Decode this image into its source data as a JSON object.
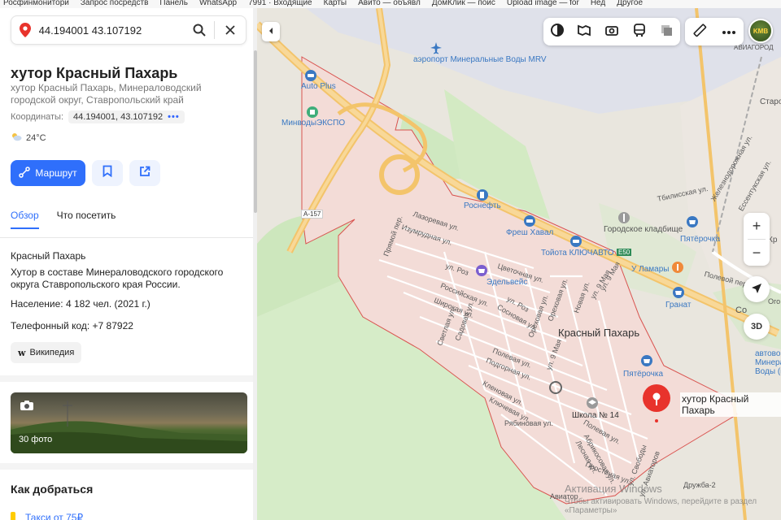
{
  "bookmarks": [
    "Росфинмонитори",
    "Запрос посредств",
    "Панель",
    "WhatsApp",
    "7991 · Входящие",
    "Карты",
    "Авито — объявл",
    "ДомКлик — поис",
    "Upload image — for",
    "Нед",
    "Другое"
  ],
  "search": {
    "value": "44.194001 43.107192"
  },
  "place": {
    "title": "хутор Красный Пахарь",
    "subtitle": "хутор Красный Пахарь, Минераловодский городской округ, Ставропольский край",
    "coords_label": "Координаты:",
    "coords_value": "44.194001, 43.107192",
    "weather": "24°C"
  },
  "actions": {
    "route_label": "Маршрут"
  },
  "tabs": [
    {
      "label": "Обзор",
      "active": true
    },
    {
      "label": "Что посетить",
      "active": false
    }
  ],
  "info": {
    "heading": "Красный Пахарь",
    "description": "Хутор в составе Минераловодского городского округа Ставропольского края России.",
    "population": "Население: 4 182 чел. (2021 г.)",
    "phone_code": "Телефонный код: +7 87922",
    "wiki_label": "Википедия"
  },
  "photos": {
    "count_label": "30 фото"
  },
  "howto": {
    "title": "Как добраться",
    "taxi": "Такси от 75₽"
  },
  "map": {
    "labels": {
      "airport": "аэропорт Минеральные Воды MRV",
      "autoplus": "Auto Plus",
      "expo": "МинводыЭКСПО",
      "a157": "А-157",
      "rosneft": "Роснефть",
      "fresh": "Фреш Хавал",
      "toyota": "Тойота КЛЮЧАВТО",
      "e50": "Е50",
      "cemetery": "Городское кладбище",
      "pyaterochka1": "Пятёрочка",
      "pyaterochka2": "Пятёрочка",
      "lamary": "У Ламары",
      "granat": "Гранат",
      "edelweiss": "Эдельвейс",
      "school": "Школа № 14",
      "village": "Красный Пахарь",
      "aviagorod": "АВИАГОРОД",
      "aviatorov": "Авиатор",
      "druzhba": "Дружба-2",
      "tbilisskaya": "Тбилисская ул.",
      "zheleznodor": "Железнодорожная ул.",
      "essentuk": "Ессентукская ул.",
      "staropol": "Старо",
      "polevoy": "Полевой пер.",
      "ogo": "Ого",
      "avtovokzal": "автовокзал Минеральные Воды (н",
      "so": "Со",
      "kr": "Кр"
    },
    "streets": [
      "Лазоревая ул.",
      "Изумрудная ул.",
      "Прямой пер.",
      "ул. Роз",
      "Цветочная ул.",
      "Российская ул.",
      "Широкая ул.",
      "Светлая ул.",
      "Садовая ул.",
      "Сосновая ул.",
      "ул. Роз",
      "Ореховая ул.",
      "Ореховая ул.",
      "Новая ул.",
      "ул. 9 Мая",
      "ул. 9 Мая",
      "Полевая ул.",
      "Подгорная ул.",
      "Кленовая ул.",
      "Ключевая ул.",
      "Рябиновая ул.",
      "Абрикосовая ул.",
      "Лесная ул.",
      "Полевая ул.",
      "Простоная ул.",
      "ул. Свободы",
      "ул. Авиаторов",
      "ул. 9 Мая"
    ],
    "pin_label": "хутор Красный Пахарь",
    "button_3d": "3D",
    "zoom_in": "+",
    "zoom_out": "−",
    "watermark_title": "Активация Windows",
    "watermark_sub": "Чтобы активировать Windows, перейдите в раздел «Параметры»"
  },
  "colors": {
    "accent": "#2f6ffb",
    "pin": "#e8332c",
    "boundary": "#d9534f",
    "highway": "#f3c46b"
  }
}
